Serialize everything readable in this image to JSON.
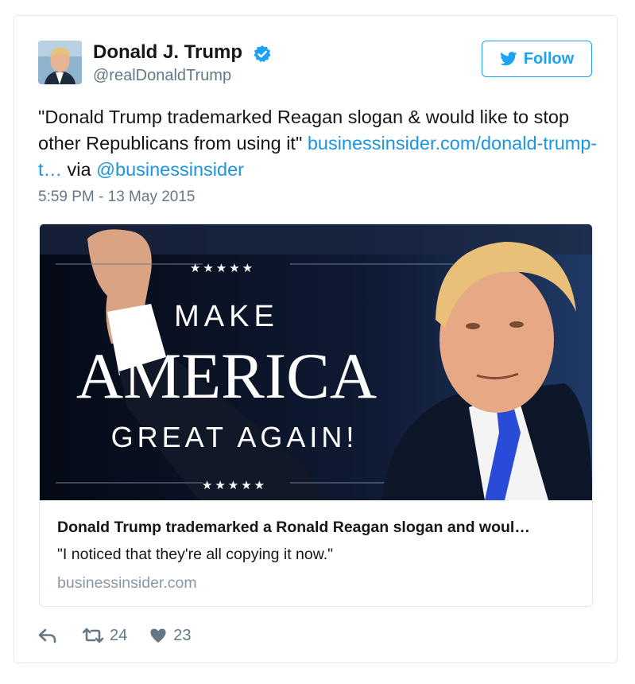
{
  "user": {
    "name": "Donald J. Trump",
    "handle": "@realDonaldTrump"
  },
  "follow": {
    "label": "Follow"
  },
  "tweet": {
    "text_part1": "\"Donald Trump trademarked Reagan slogan & would like to stop other Republicans from using it\" ",
    "link": "businessinsider.com/donald-trump-t…",
    "via": " via ",
    "mention": "@businessinsider",
    "timestamp": "5:59 PM - 13 May 2015"
  },
  "card": {
    "image_text": {
      "stars_top": "★★★★★",
      "make": "MAKE",
      "america": "AMERICA",
      "great_again": "GREAT AGAIN!",
      "stars_bottom": "★★★★★"
    },
    "title": "Donald Trump trademarked a Ronald Reagan slogan and woul…",
    "description": "\"I noticed that they're all copying it now.\"",
    "domain": "businessinsider.com"
  },
  "actions": {
    "retweets": "24",
    "likes": "23"
  },
  "colors": {
    "twitter_blue": "#1da1f2",
    "link_blue": "#1b95e0",
    "secondary_gray": "#657786"
  }
}
